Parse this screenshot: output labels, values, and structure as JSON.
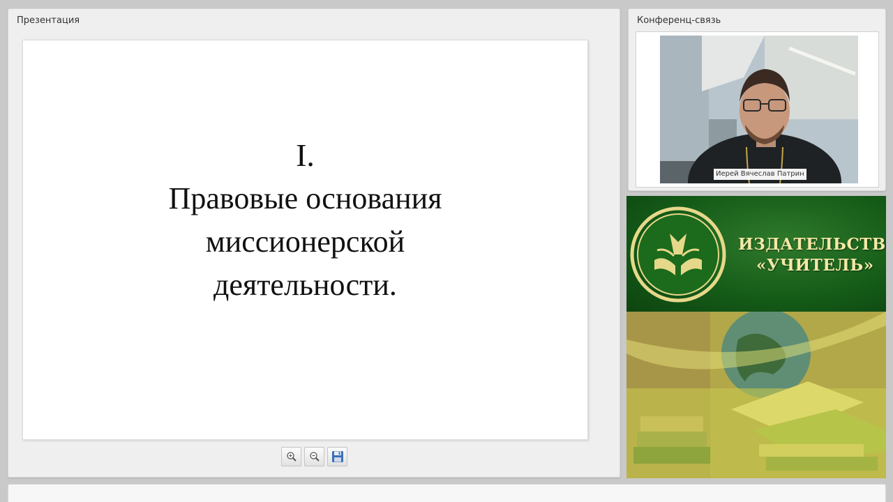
{
  "presentation": {
    "title": "Презентация",
    "slide": {
      "number": "I.",
      "lines": [
        "Правовые основания",
        "миссионерской",
        "деятельности."
      ]
    },
    "toolbar": [
      {
        "icon": "zoom-in-icon"
      },
      {
        "icon": "zoom-out-icon"
      },
      {
        "icon": "save-icon"
      }
    ]
  },
  "conference": {
    "title": "Конференц-связь",
    "speaker_name": "Иерей Вячеслав Патрин"
  },
  "banner": {
    "publisher_line1": "ИЗДАТЕЛЬСТВО",
    "publisher_line2": "«УЧИТЕЛЬ»",
    "colors": {
      "green": "#145a17",
      "gold": "#f4e9a6",
      "logo_ring": "#e6d88a"
    }
  }
}
